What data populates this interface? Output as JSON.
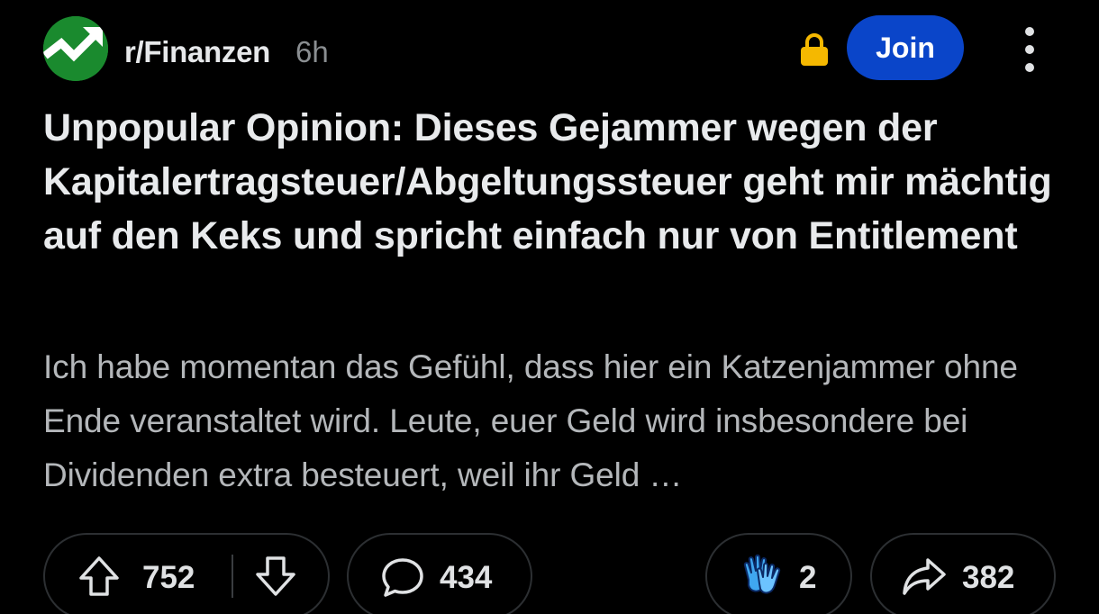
{
  "post": {
    "subreddit": "r/Finanzen",
    "age": "6h",
    "join_label": "Join",
    "title": "Unpopular Opinion: Dieses Gejammer wegen der Kapitalertragsteuer/Abgeltungssteuer geht mir mächtig auf den Keks und spricht einfach nur von Entitlement",
    "body": "Ich habe momentan das Gefühl, dass hier ein Katzenjammer ohne Ende veranstaltet wird. Leute, euer Geld wird insbesondere bei Dividenden extra besteuert, weil ihr Geld …"
  },
  "actions": {
    "upvotes": "752",
    "comments": "434",
    "awards": "2",
    "shares": "382"
  },
  "icons": {
    "avatar": "stocks-up-arrow-icon",
    "lock": "lock-icon",
    "more": "more-vertical-icon",
    "upvote": "upvote-arrow-icon",
    "downvote": "downvote-arrow-icon",
    "comment": "comment-bubble-icon",
    "award": "clapping-hands-icon",
    "share": "share-arrow-icon"
  },
  "colors": {
    "background": "#000000",
    "join_button": "#0a45c9",
    "avatar_bg": "#1a8a2e",
    "lock": "#f5b800"
  }
}
